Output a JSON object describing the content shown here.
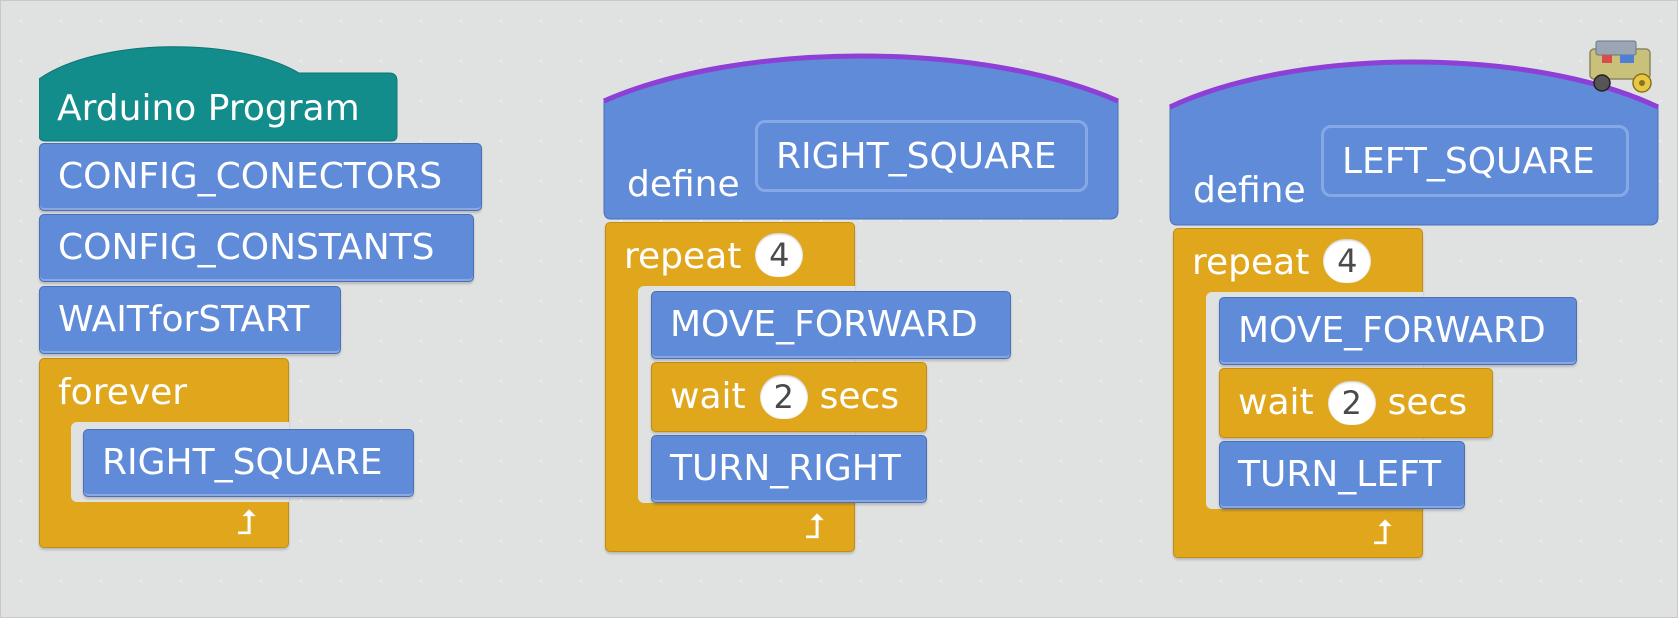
{
  "colors": {
    "motion_blue": "#5f8bd9",
    "control_orange": "#e1a71c",
    "arduino_teal": "#138c8c",
    "define_accent": "#8d3fd6",
    "canvas": "#e0e2e1"
  },
  "scripts": {
    "main": {
      "hat": "Arduino  Program",
      "steps": [
        "CONFIG_CONECTORS",
        "CONFIG_CONSTANTS",
        "WAITforSTART"
      ],
      "forever_label": "forever",
      "forever_body": "RIGHT_SQUARE",
      "loop_icon": "loop-arrow-icon"
    },
    "right_square": {
      "define_label": "define",
      "name": "RIGHT_SQUARE",
      "repeat_label": "repeat",
      "repeat_count": "4",
      "move": "MOVE_FORWARD",
      "wait_label": "wait",
      "wait_value": "2",
      "secs_label": "secs",
      "turn": "TURN_RIGHT",
      "loop_icon": "loop-arrow-icon"
    },
    "left_square": {
      "define_label": "define",
      "name": "LEFT_SQUARE",
      "repeat_label": "repeat",
      "repeat_count": "4",
      "move": "MOVE_FORWARD",
      "wait_label": "wait",
      "wait_value": "2",
      "secs_label": "secs",
      "turn": "TURN_LEFT",
      "loop_icon": "loop-arrow-icon"
    }
  },
  "sprite_icon": "robot-sprite-icon"
}
